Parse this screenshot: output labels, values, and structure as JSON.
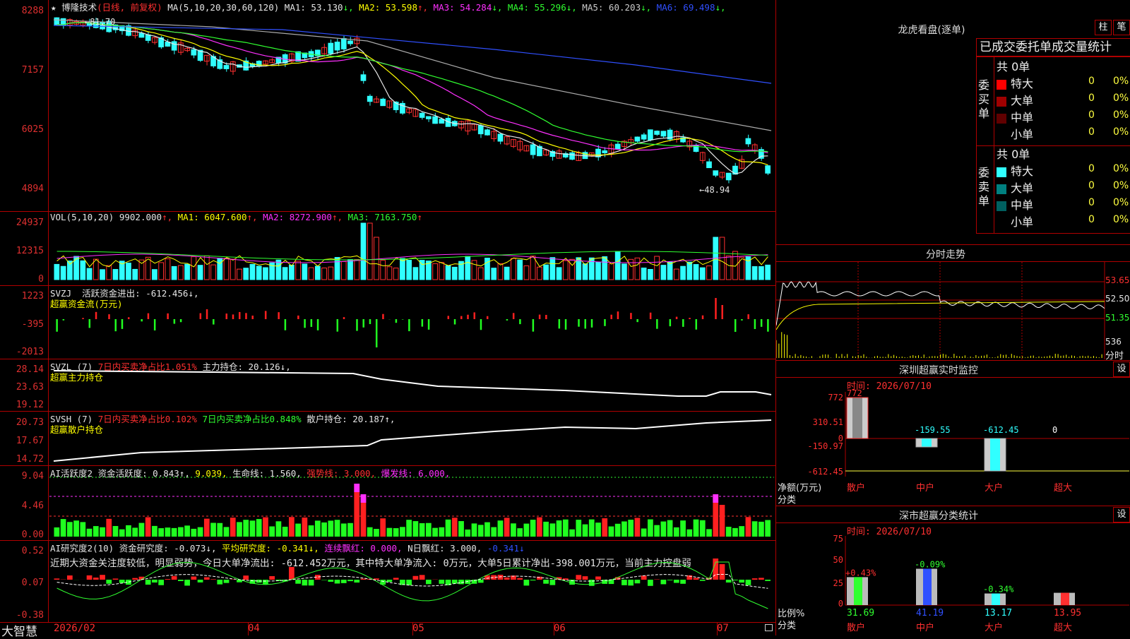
{
  "stock": {
    "star": "★",
    "name": "博隆技术",
    "period": "(日线, 前复权)",
    "ma_label": "MA(5,10,20,30,60,120)",
    "ma": [
      {
        "label": "MA1:",
        "value": "53.130",
        "arrow": "↓",
        "color": "#e6e6e6"
      },
      {
        "label": "MA2:",
        "value": "53.598",
        "arrow": "↑",
        "color": "#ffff00"
      },
      {
        "label": "MA3:",
        "value": "54.284",
        "arrow": "↓",
        "color": "#ff30ff"
      },
      {
        "label": "MA4:",
        "value": "55.296",
        "arrow": "↓",
        "color": "#30ff30"
      },
      {
        "label": "MA5:",
        "value": "60.203",
        "arrow": "↓",
        "color": "#cccccc"
      },
      {
        "label": "MA6:",
        "value": "69.498",
        "arrow": "↓",
        "color": "#3050ff"
      }
    ],
    "y_ticks": [
      "8288",
      "7157",
      "6025",
      "4894"
    ],
    "high_label": "←81.70",
    "low_label": "←48.94"
  },
  "volume": {
    "title": "VOL(5,10,20)",
    "value": "9902.000",
    "ma1": "6047.600",
    "ma2": "8272.900",
    "ma3": "7163.750",
    "y_ticks": [
      "24937",
      "12315",
      "0"
    ]
  },
  "svzj": {
    "title": "SVZJ",
    "text": "活跃资金进出: -612.456↓,",
    "subtitle": "超赢资金流(万元)",
    "y_ticks": [
      "1223",
      "-395",
      "-2013"
    ]
  },
  "svzl": {
    "title": "SVZL (7)",
    "ratio": "7日内买卖净占比1.051%",
    "hold": "主力持仓: 20.126↓,",
    "subtitle": "超赢主力持仓",
    "y_ticks": [
      "28.14",
      "23.63",
      "19.12"
    ]
  },
  "svsh": {
    "title": "SVSH (7)",
    "ratio1": "7日内买卖净占比0.102%",
    "ratio2": "7日内买卖净占比0.848%",
    "hold": "散户持仓: 20.187↑,",
    "subtitle": "超赢散户持仓",
    "y_ticks": [
      "20.73",
      "17.67",
      "14.72"
    ]
  },
  "ai_active": {
    "title": "AI活跃度2",
    "active": "资金活跃度: 0.843↑,",
    "v2": "9.039,",
    "life": "生命线: 1.560,",
    "strong": "强势线: 3.000,",
    "burst": "爆发线: 6.000,",
    "y_ticks": [
      "9.04",
      "4.46",
      "0.00"
    ]
  },
  "ai_research": {
    "title": "AI研究度2(10)",
    "research": "资金研究度: -0.073↓,",
    "avg": "平均研究度: -0.341↓,",
    "cont": "连续飘红: 0.000,",
    "nday": "N日飘红: 3.000,",
    "last": "-0.341↓",
    "comment": "近期大资金关注度较低，明显弱势，今日大单净流出: -612.452万元，其中特大单净流入: 0万元，大单5日累计净出-398.001万元，当前主力控盘弱",
    "y_ticks": [
      "0.52",
      "0.07",
      "-0.38"
    ]
  },
  "x_axis": {
    "brand": "大智慧",
    "labels": [
      "2026/02",
      "04",
      "05",
      "06",
      "07"
    ]
  },
  "right_panel": {
    "dragon_title": "龙虎看盘(逐单)",
    "btn_bar": "柱",
    "btn_pen": "笔",
    "stat_title": "已成交委托单成交量统计",
    "buy_side": "委买单",
    "sell_side": "委卖单",
    "buy_total": "共 0单",
    "sell_total": "共 0单",
    "rows": [
      {
        "label": "特大",
        "count": "0",
        "pct": "0%"
      },
      {
        "label": "大单",
        "count": "0",
        "pct": "0%"
      },
      {
        "label": "中单",
        "count": "0",
        "pct": "0%"
      },
      {
        "label": "小单",
        "count": "0",
        "pct": "0%"
      }
    ],
    "buy_colors": [
      "#ff0000",
      "#a00000",
      "#600000",
      "#000000"
    ],
    "sell_colors": [
      "#30ffff",
      "#008080",
      "#006060",
      "#000000"
    ],
    "fenshi_title": "分时走势",
    "fenshi_prices": [
      "53.65",
      "52.50",
      "51.35"
    ],
    "fenshi_vol": "536",
    "fenshi_label": "分时",
    "sz_monitor": "深圳超赢实时监控",
    "set": "设",
    "time1": "时间: 2026/07/10",
    "mon_ticks": [
      "772",
      "310.51",
      "0",
      "-150.97",
      "-612.45"
    ],
    "mon_values": [
      {
        "cat": "散户",
        "val": "772"
      },
      {
        "cat": "中户",
        "val": "-159.55"
      },
      {
        "cat": "大户",
        "val": "-612.45"
      },
      {
        "cat": "超大",
        "val": "0"
      }
    ],
    "net_label": "净额(万元)",
    "cat_label": "分类",
    "sz_class": "深市超赢分类统计",
    "time2": "时间: 2026/07/10",
    "cls_ticks": [
      "75",
      "50",
      "25",
      "0"
    ],
    "cls_values": [
      {
        "cat": "散户",
        "ratio": "31.69",
        "chg": "+0.43%"
      },
      {
        "cat": "中户",
        "ratio": "41.19",
        "chg": "-0.09%"
      },
      {
        "cat": "大户",
        "ratio": "13.17",
        "chg": "-0.34%"
      },
      {
        "cat": "超大",
        "ratio": "13.95",
        "chg": ""
      }
    ],
    "ratio_label": "比例%",
    "cat_label2": "分类"
  }
}
